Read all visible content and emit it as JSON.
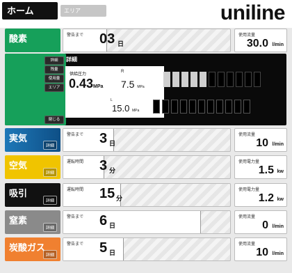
{
  "header": {
    "tab_home": "ホーム",
    "tab_area": "エリア",
    "logo": "uniline"
  },
  "colors": {
    "oxygen": "#16a05a",
    "air_cyan": "#1a6fae",
    "air_yellow": "#f0c400",
    "suction": "#111111",
    "nitrogen": "#8a8a8a",
    "co2": "#f08030"
  },
  "oxygen": {
    "label": "酸素",
    "caption": "警告まで",
    "value": "03",
    "unit": "日",
    "right_caption": "使用流量",
    "right_value": "30.0",
    "right_unit": "l/min",
    "fill_percent": 26
  },
  "detail": {
    "buttons": [
      "詳細",
      "残量",
      "使用量",
      "エリア",
      "閉じる"
    ],
    "title": "詳細",
    "supply_caption": "供給圧力",
    "supply_value": "0.43",
    "supply_unit": "MPa",
    "r_label": "R",
    "r_value": "7.5",
    "r_unit": "MPa",
    "l_label": "L",
    "l_value": "15.0",
    "l_unit": "MPa",
    "r_level_segments_on": 5,
    "r_segments_total": 11,
    "l_segments_total": 11
  },
  "rows": [
    {
      "key": "air",
      "label": "実気",
      "sub": "詳細",
      "caption": "警告まで",
      "value": "3",
      "unit": "日",
      "right_caption": "使用流量",
      "right_value": "10",
      "right_unit": "l/min",
      "fill_percent": 30
    },
    {
      "key": "air2",
      "label": "空気",
      "sub": "詳細",
      "caption": "運転時間",
      "value": "3",
      "unit": "分",
      "right_caption": "使用電力量",
      "right_value": "1.5",
      "right_unit": "kw",
      "fill_percent": 24
    },
    {
      "key": "suction",
      "label": "吸引",
      "sub": "詳細",
      "caption": "運転時間",
      "value": "15",
      "unit": "分",
      "right_caption": "使用電力量",
      "right_value": "1.2",
      "right_unit": "kw",
      "fill_percent": 34
    },
    {
      "key": "nitrogen",
      "label": "窒素",
      "sub": "詳細",
      "caption": "警告まで",
      "value": "6",
      "unit": "日",
      "right_caption": "使用流量",
      "right_value": "0",
      "right_unit": "l/min",
      "fill_percent": 82
    },
    {
      "key": "co2",
      "label": "炭酸ガス",
      "sub": "詳細",
      "caption": "警告まで",
      "value": "5",
      "unit": "日",
      "right_caption": "使用流量",
      "right_value": "10",
      "right_unit": "l/min",
      "fill_percent": 36
    }
  ]
}
